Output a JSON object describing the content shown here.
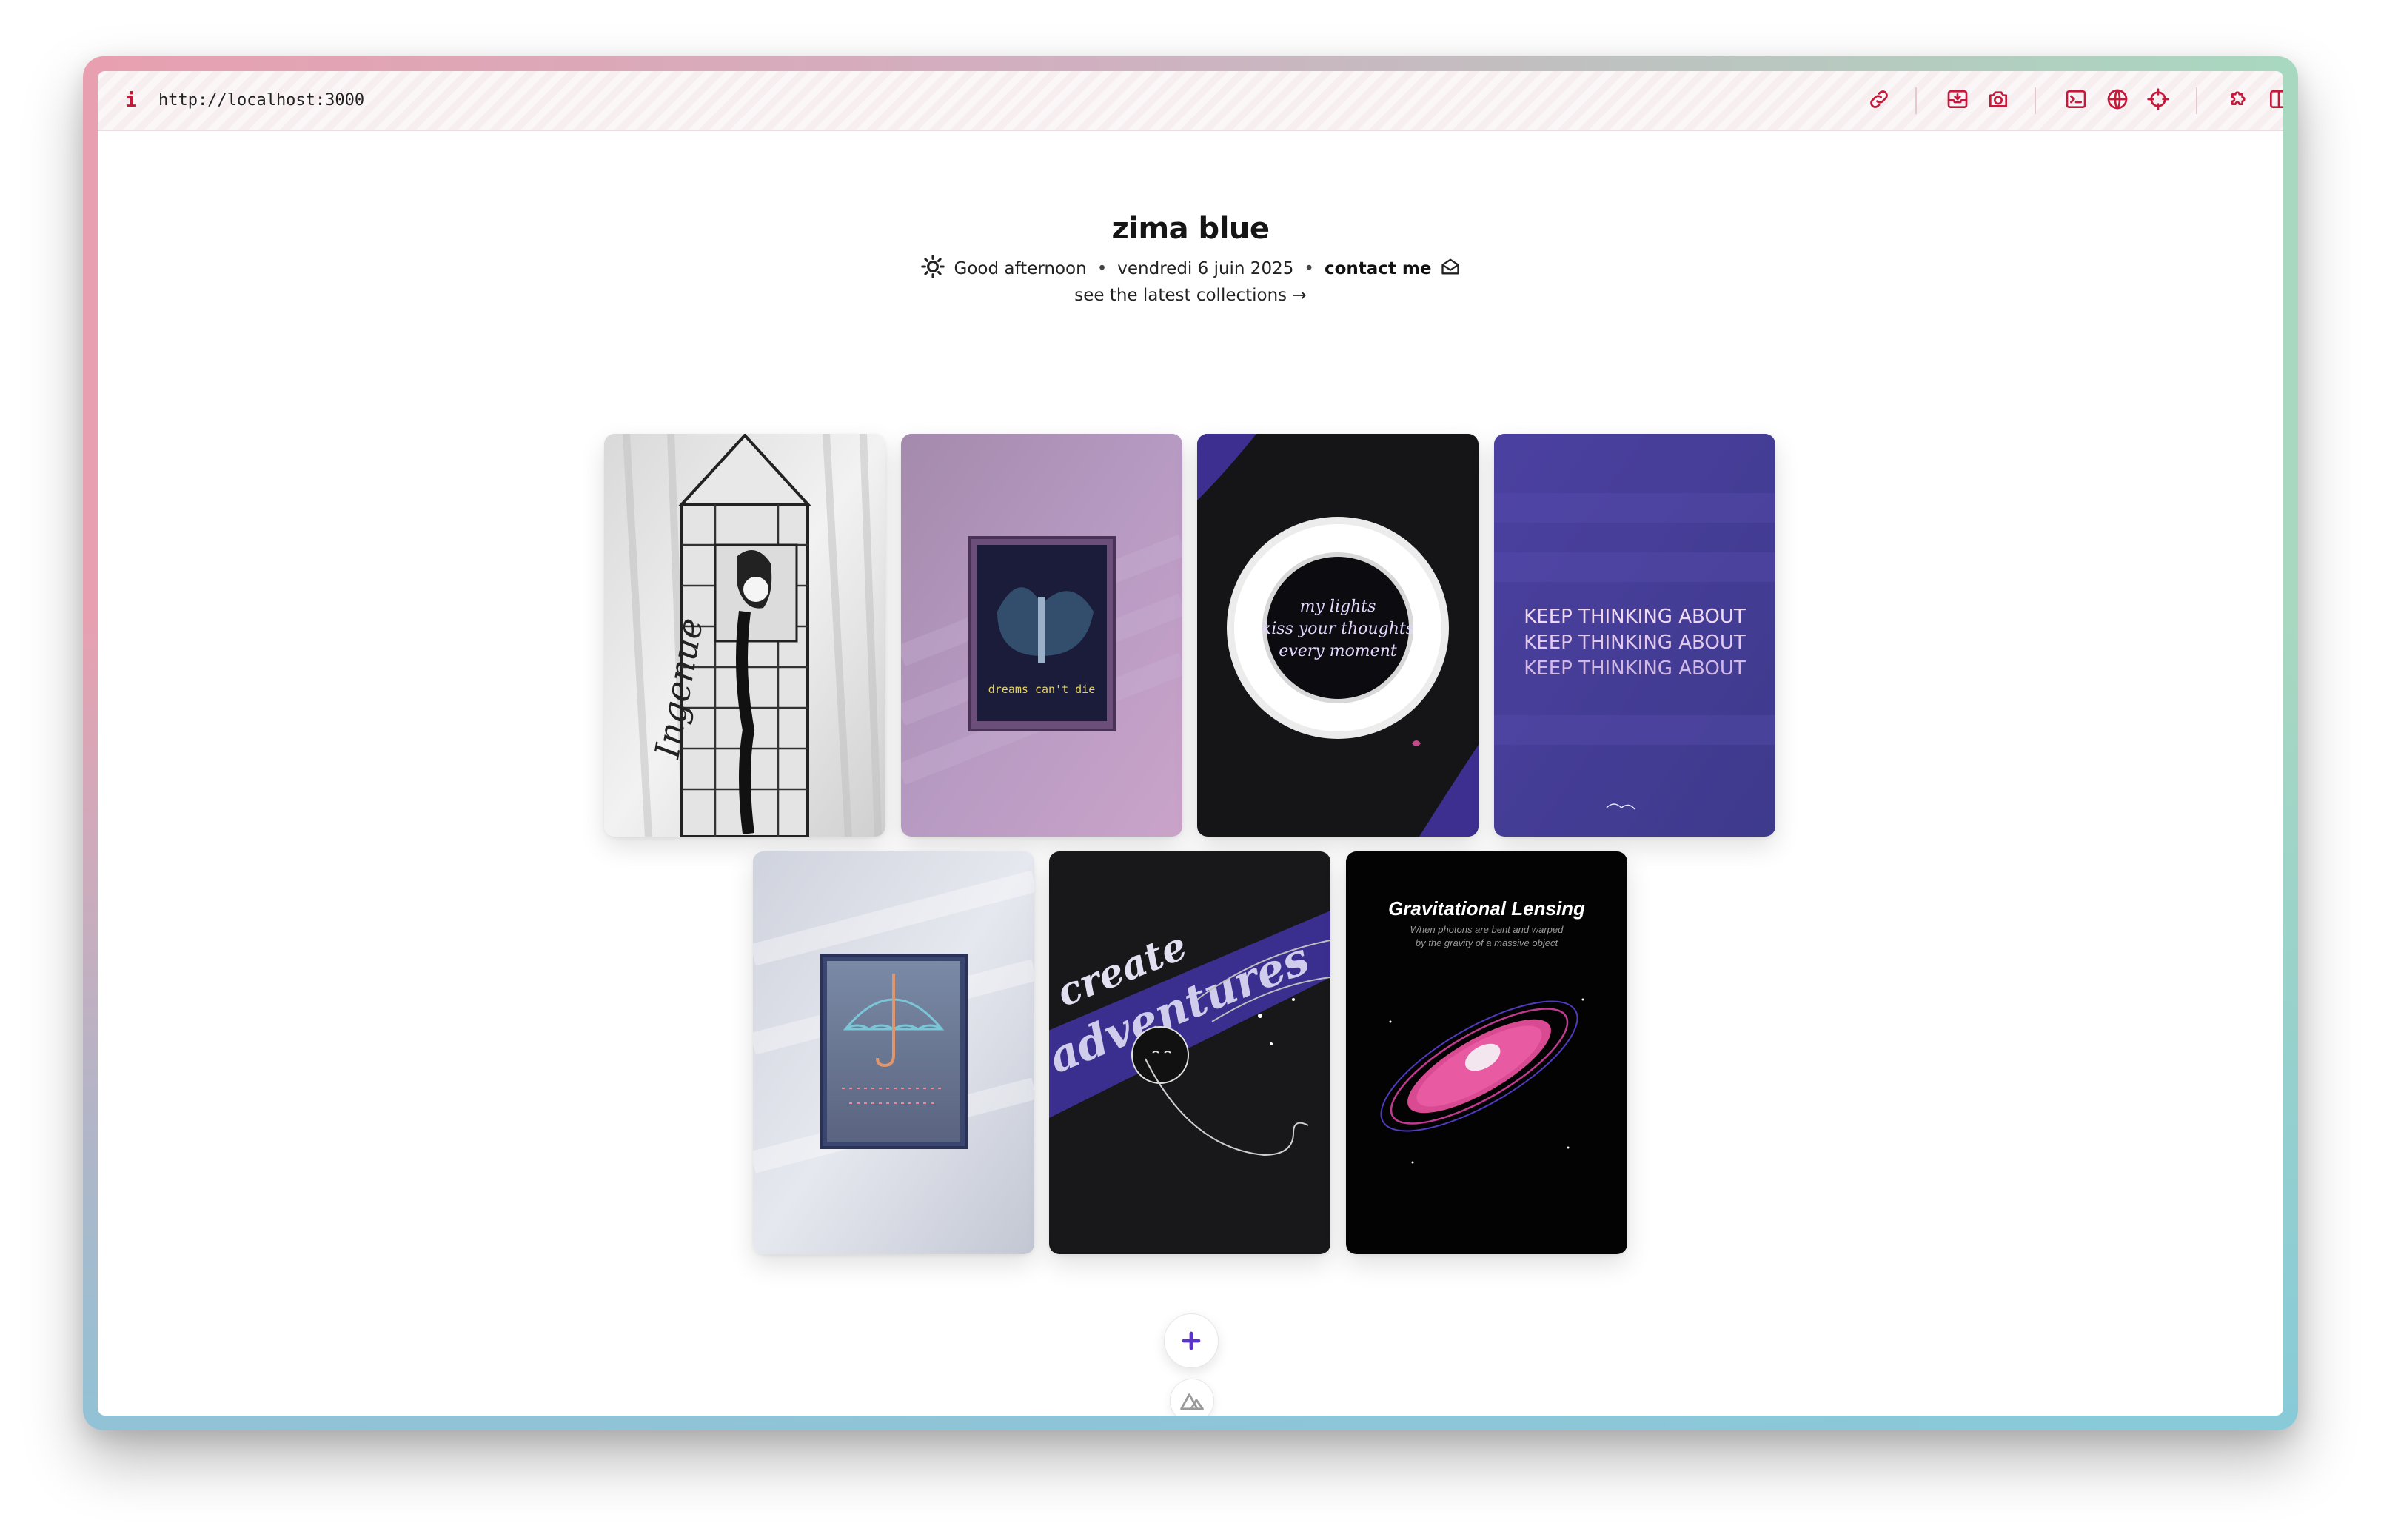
{
  "browser": {
    "url": "http://localhost:3000",
    "info_icon": "i",
    "toolbar_icons": [
      "link-icon",
      "inbox-icon",
      "camera-icon",
      "terminal-icon",
      "globe-icon",
      "crosshair-icon",
      "puzzle-icon",
      "split-view-icon"
    ]
  },
  "site": {
    "title": "zima blue",
    "greeting": "Good afternoon",
    "date": "vendredi 6 juin 2025",
    "contact": "contact me",
    "separator": "•",
    "collections_link": "see the latest collections →"
  },
  "gallery": {
    "cards": [
      {
        "name": "ingenue",
        "text": "Ingenue"
      },
      {
        "name": "dreams-cant-die",
        "text": "dreams can't die"
      },
      {
        "name": "my-lights",
        "lines": [
          "my lights",
          "kiss your thoughts",
          "every moment"
        ]
      },
      {
        "name": "keep-thinking-about",
        "lines": [
          "KEEP THINKING ABOUT",
          "KEEP THINKING ABOUT",
          "KEEP THINKING ABOUT"
        ]
      },
      {
        "name": "umbrella",
        "text": ""
      },
      {
        "name": "create-adventures",
        "lines": [
          "create",
          "adventures"
        ]
      },
      {
        "name": "gravitational-lensing",
        "title": "Gravitational Lensing",
        "subtitle_1": "When photons are bent and warped",
        "subtitle_2": "by the gravity of a massive object"
      }
    ]
  },
  "colors": {
    "accent": "#c5183a",
    "plus": "#5a35c8"
  }
}
